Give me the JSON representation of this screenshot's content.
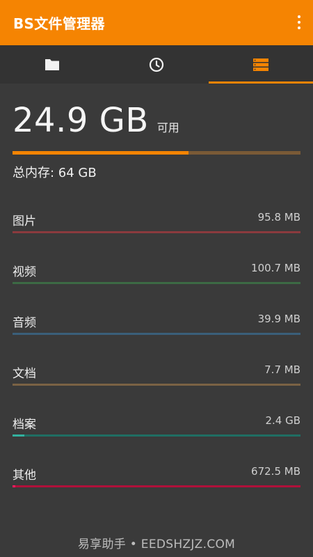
{
  "appbar": {
    "title": "BS文件管理器",
    "menu_icon": "more-vert-icon"
  },
  "tabs": [
    {
      "icon": "folder-icon",
      "selected": false
    },
    {
      "icon": "clock-icon",
      "selected": false
    },
    {
      "icon": "storage-icon",
      "selected": true
    }
  ],
  "storage": {
    "free_value": "24.9 GB",
    "free_label": "可用",
    "used_fraction": 0.61,
    "total_text": "总内存: 64 GB"
  },
  "categories": [
    {
      "label": "图片",
      "size": "95.8 MB",
      "fraction": 0.0,
      "color": "#8b3a3e"
    },
    {
      "label": "视频",
      "size": "100.7 MB",
      "fraction": 0.0,
      "color": "#3c6a44"
    },
    {
      "label": "音频",
      "size": "39.9 MB",
      "fraction": 0.0,
      "color": "#3a5f7a"
    },
    {
      "label": "文档",
      "size": "7.7 MB",
      "fraction": 0.0,
      "color": "#7a6244"
    },
    {
      "label": "档案",
      "size": "2.4 GB",
      "fraction": 0.04,
      "color": "#1f6e63"
    },
    {
      "label": "其他",
      "size": "672.5 MB",
      "fraction": 0.01,
      "color": "#b0103a"
    }
  ],
  "colors": {
    "accent": "#f58402",
    "background": "#3a3a3a"
  },
  "watermark": "易享助手 • EEDSHZJZ.COM"
}
